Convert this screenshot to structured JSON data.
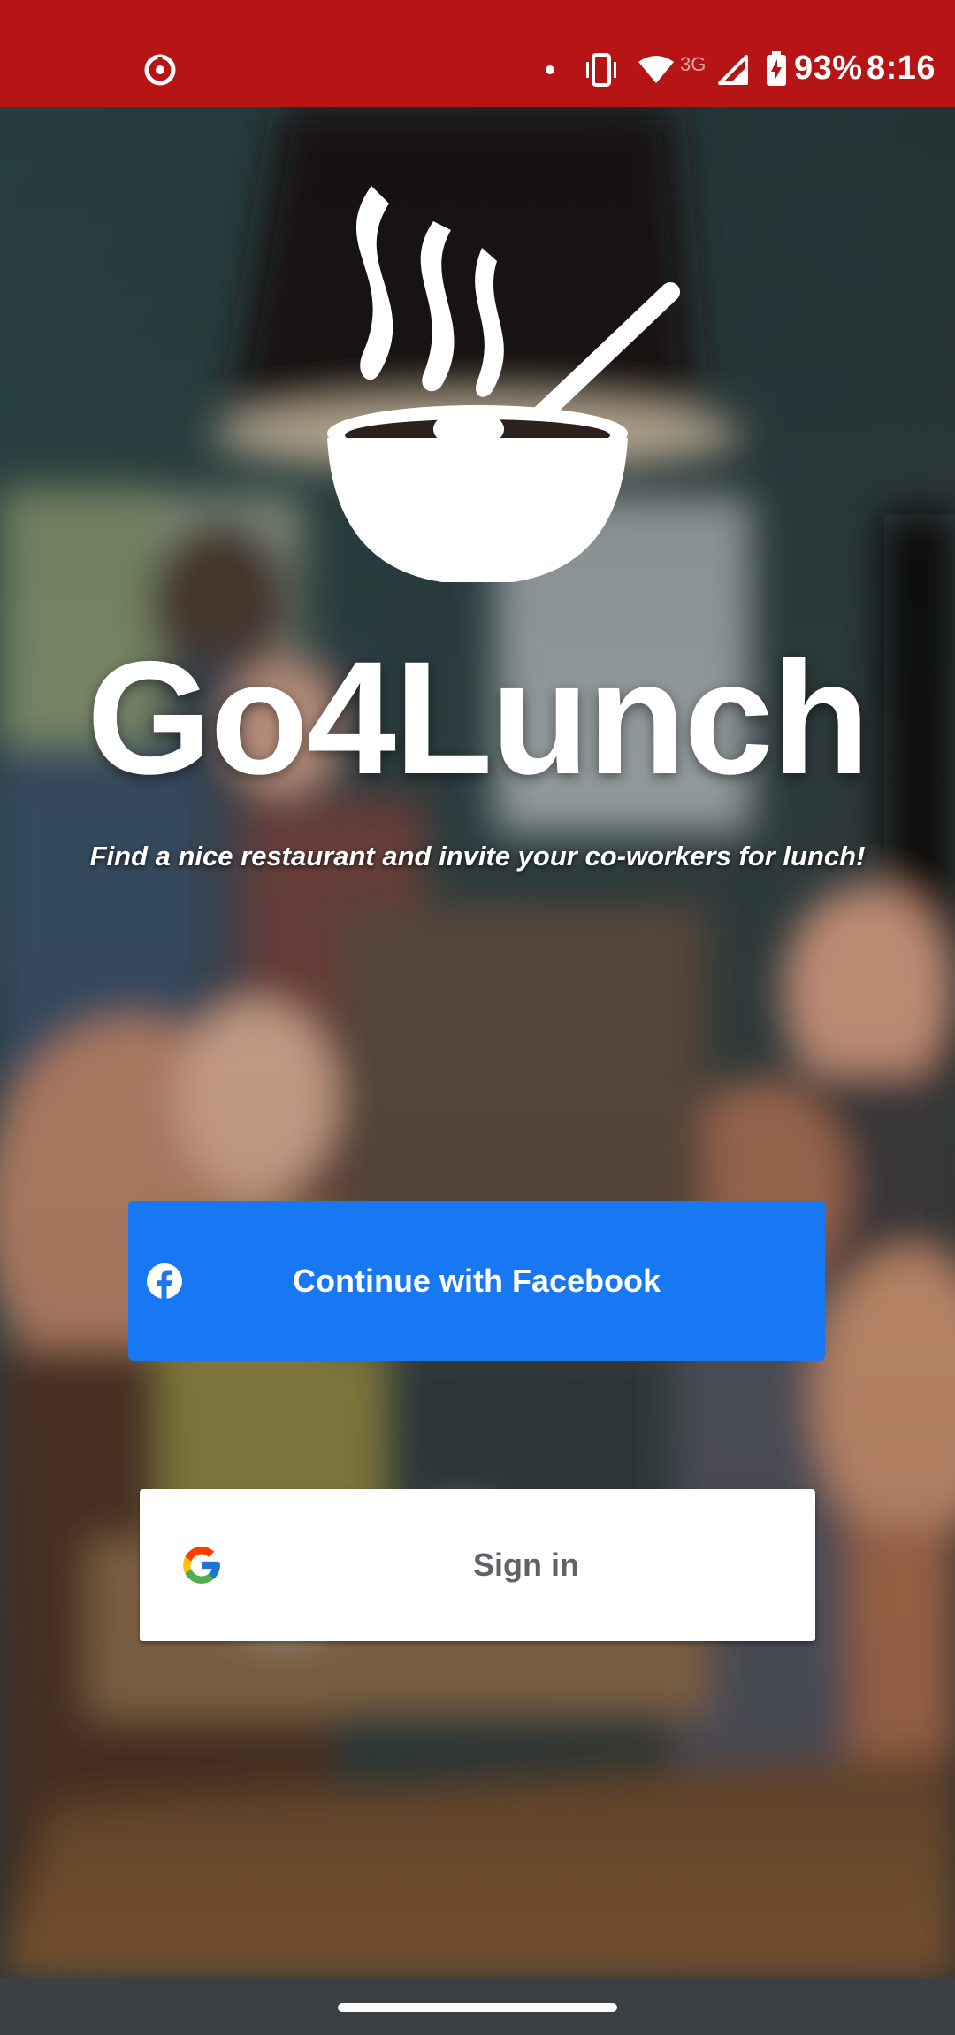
{
  "status_bar": {
    "left_icon": "data-saver-icon",
    "notification_dot": "notification-dot",
    "vibrate_icon": "vibrate-icon",
    "wifi_icon": "wifi-icon",
    "network_type": "3G",
    "signal_icon": "cell-signal-icon",
    "battery_icon": "battery-charging-icon",
    "battery_percent": "93%",
    "time": "8:16"
  },
  "splash": {
    "logo_icon": "steaming-bowl-icon",
    "title": "Go4Lunch",
    "tagline": "Find a nice restaurant and invite your co-workers for lunch!"
  },
  "auth": {
    "facebook_button_label": "Continue with Facebook",
    "facebook_icon": "facebook-icon",
    "google_button_label": "Sign in",
    "google_icon": "google-icon"
  },
  "colors": {
    "status_bar": "#b71515",
    "facebook_blue": "#1877f2",
    "google_text": "#5f6368",
    "nav_bar": "#3c4043"
  }
}
